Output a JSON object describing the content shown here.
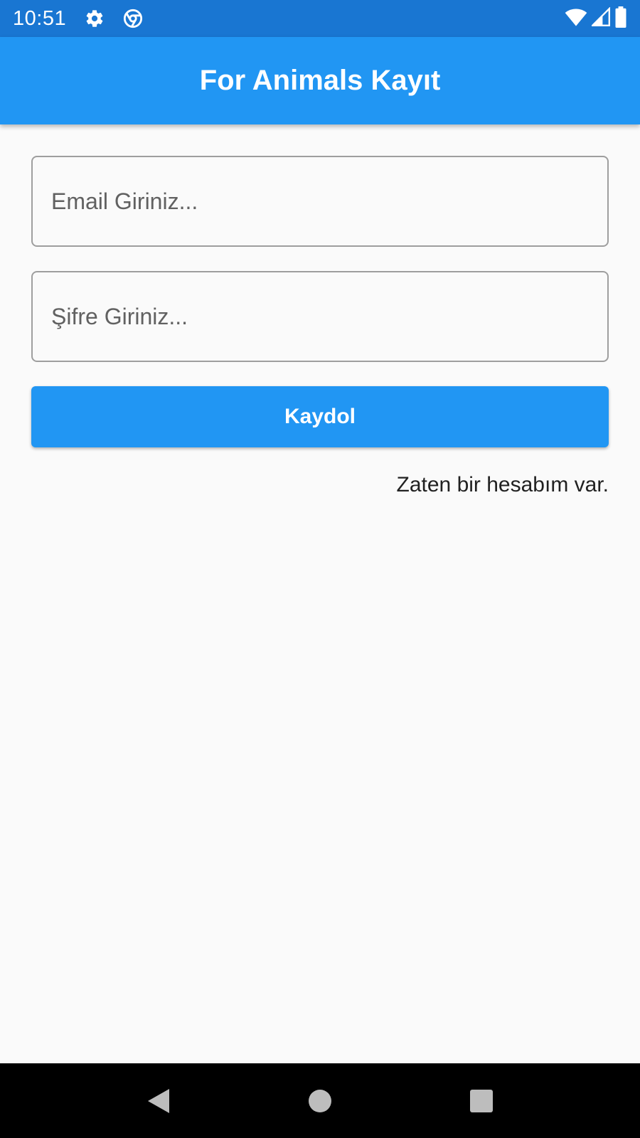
{
  "status_bar": {
    "time": "10:51",
    "icons": [
      "gear-icon",
      "chrome-icon",
      "wifi-icon",
      "signal-icon",
      "battery-icon"
    ]
  },
  "app_bar": {
    "title": "For Animals Kayıt",
    "color": "#2196f3"
  },
  "form": {
    "email": {
      "value": "",
      "placeholder": "Email Giriniz..."
    },
    "password": {
      "value": "",
      "placeholder": "Şifre Giriniz..."
    },
    "submit_label": "Kaydol",
    "login_link": "Zaten bir hesabım var."
  },
  "nav_bar": {
    "icons": [
      "back-icon",
      "home-icon",
      "recents-icon"
    ]
  },
  "colors": {
    "status_bar": "#1976d2",
    "primary": "#2196f3",
    "background": "#fafafa"
  }
}
